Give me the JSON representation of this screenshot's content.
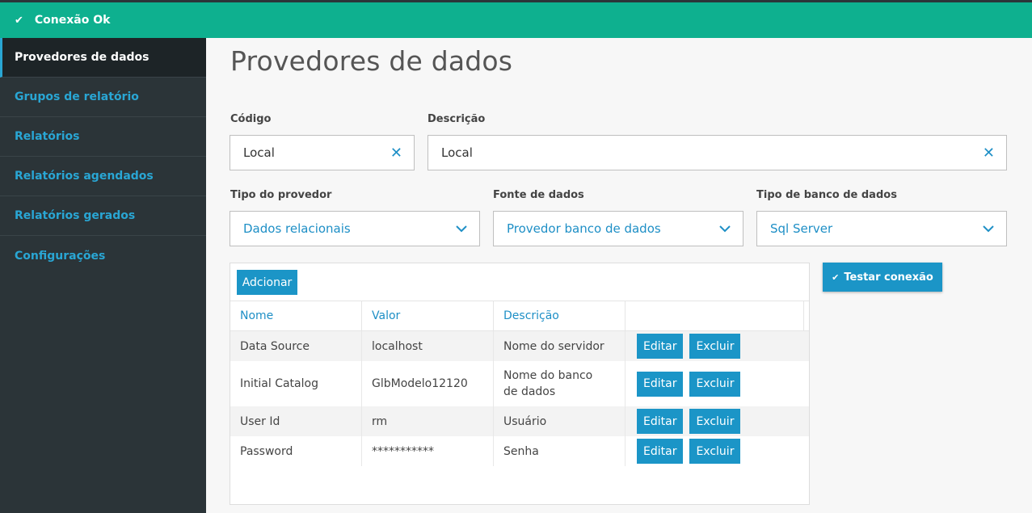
{
  "status_bar": {
    "text": "Conexão Ok",
    "color": "#0eb08f"
  },
  "sidebar": {
    "items": [
      {
        "label": "Provedores de dados"
      },
      {
        "label": "Grupos de relatório"
      },
      {
        "label": "Relatórios"
      },
      {
        "label": "Relatórios agendados"
      },
      {
        "label": "Relatórios gerados"
      },
      {
        "label": "Configurações"
      }
    ]
  },
  "page": {
    "title": "Provedores de dados"
  },
  "form": {
    "codigo": {
      "label": "Código",
      "value": "Local"
    },
    "descricao": {
      "label": "Descrição",
      "value": "Local"
    },
    "tipo_provedor": {
      "label": "Tipo do provedor",
      "value": "Dados relacionais"
    },
    "fonte_dados": {
      "label": "Fonte de dados",
      "value": "Provedor banco de dados"
    },
    "tipo_banco": {
      "label": "Tipo de banco de dados",
      "value": "Sql Server"
    }
  },
  "table": {
    "add_label": "Adcionar",
    "headers": [
      "Nome",
      "Valor",
      "Descrição"
    ],
    "edit_label": "Editar",
    "delete_label": "Excluir",
    "rows": [
      {
        "nome": "Data Source",
        "valor": "localhost",
        "descricao": "Nome do servidor"
      },
      {
        "nome": "Initial Catalog",
        "valor": "GlbModelo12120",
        "descricao": "Nome do banco de dados"
      },
      {
        "nome": "User Id",
        "valor": "rm",
        "descricao": "Usuário"
      },
      {
        "nome": "Password",
        "valor": "***********",
        "descricao": "Senha"
      }
    ]
  },
  "test_button": {
    "label": "Testar conexão"
  }
}
